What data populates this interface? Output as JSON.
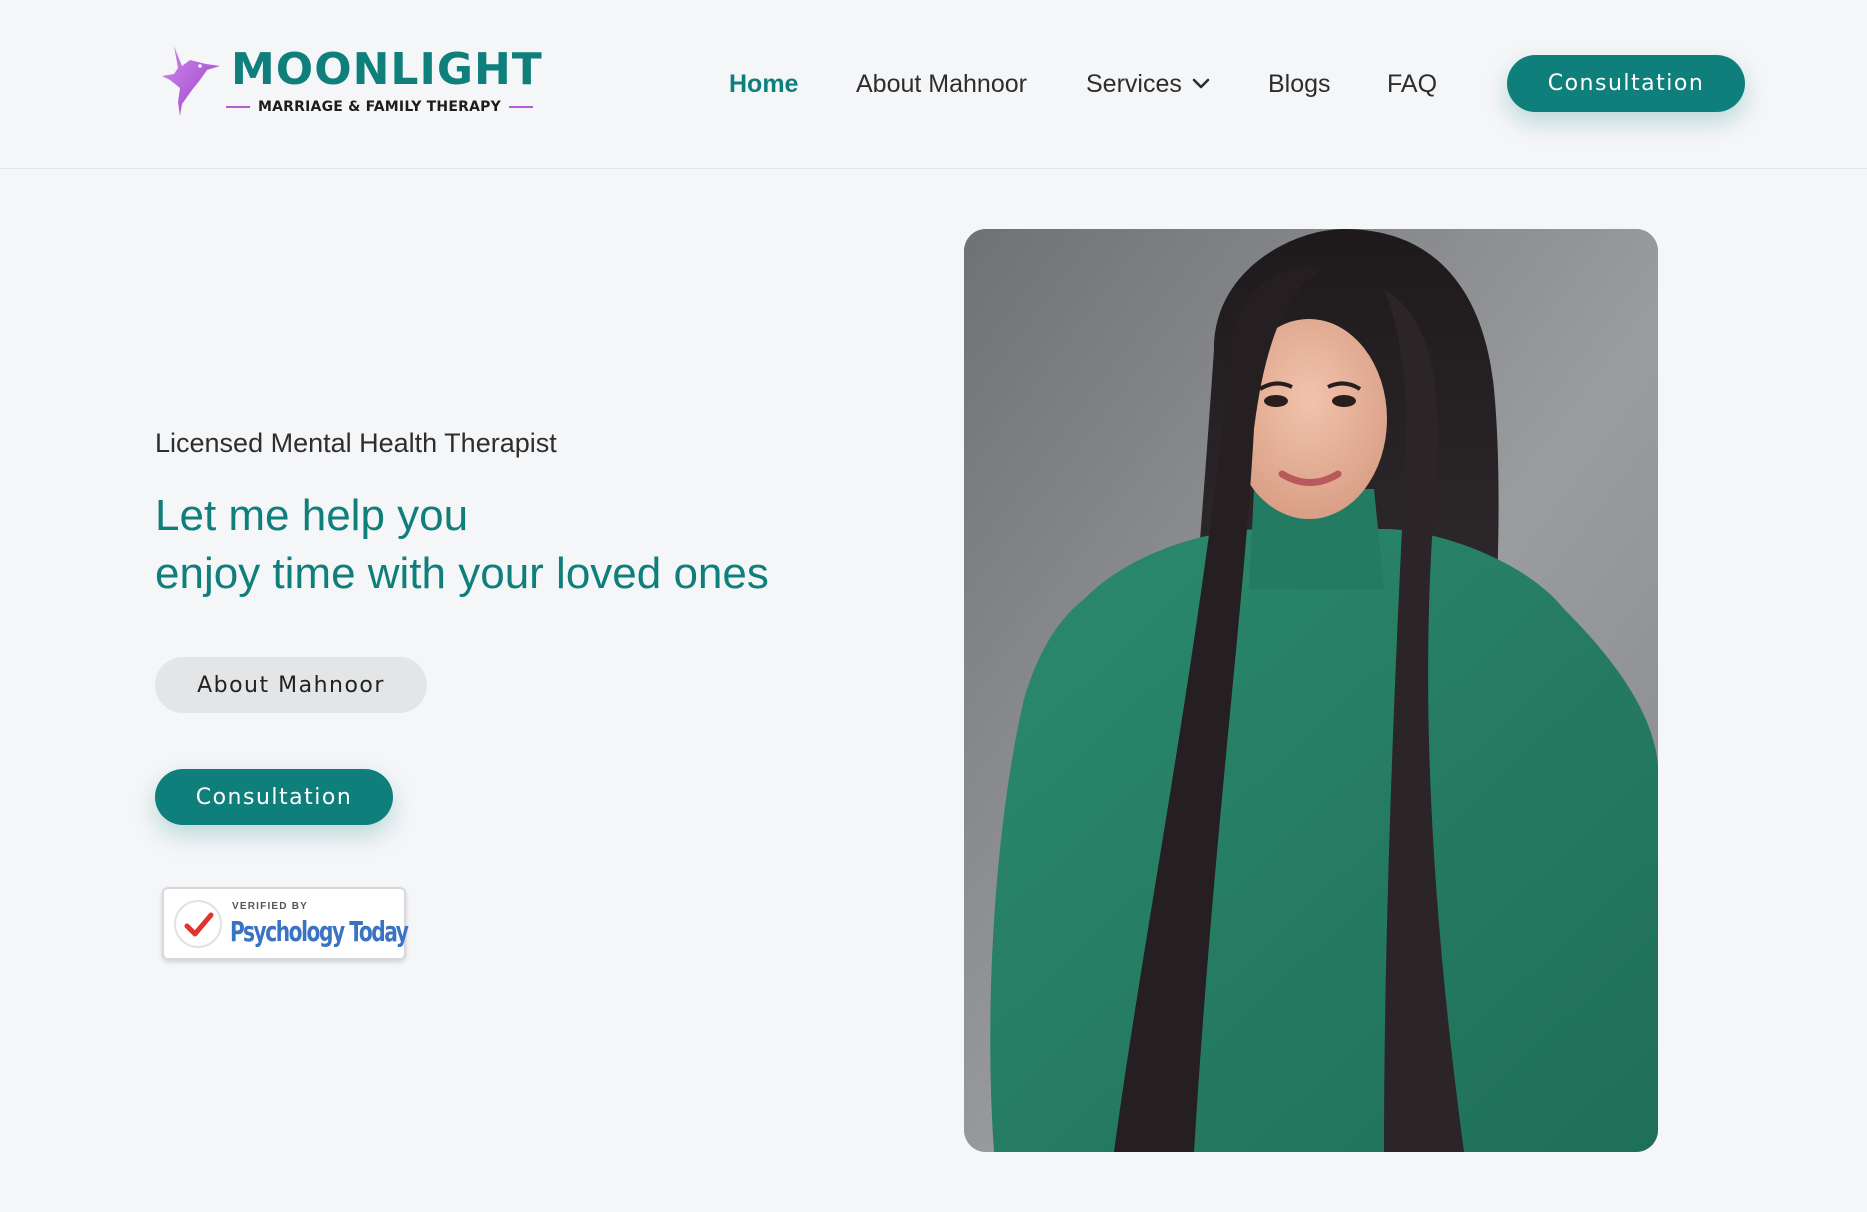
{
  "brand": {
    "name": "MOONLIGHT",
    "tagline": "MARRIAGE & FAMILY THERAPY",
    "logo_icon": "hummingbird-icon"
  },
  "nav": {
    "items": [
      {
        "label": "Home",
        "active": true
      },
      {
        "label": "About Mahnoor",
        "active": false
      },
      {
        "label": "Services",
        "active": false,
        "has_dropdown": true
      },
      {
        "label": "Blogs",
        "active": false
      },
      {
        "label": "FAQ",
        "active": false
      }
    ],
    "cta_label": "Consultation"
  },
  "hero": {
    "subtitle": "Licensed Mental Health Therapist",
    "headline_line1": "Let me help you",
    "headline_line2": "enjoy time with your loved ones",
    "about_button_label": "About Mahnoor",
    "consultation_button_label": "Consultation",
    "badge": {
      "verified_text": "VERIFIED BY",
      "brand_text": "Psychology Today"
    },
    "photo": {
      "icon": "portrait-photo"
    }
  },
  "colors": {
    "accent": "#0f7f7c",
    "logo_purple": "#b35ed6",
    "background": "#f5f6f8",
    "secondary_button": "#e4e5e7"
  }
}
